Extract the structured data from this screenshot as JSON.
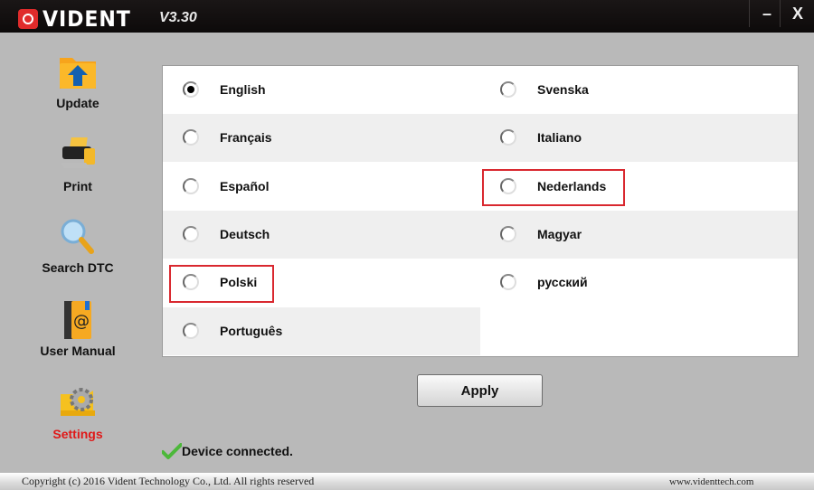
{
  "app": {
    "brand": "VIDENT",
    "version": "V3.30",
    "minimize_label": "–",
    "close_label": "X"
  },
  "sidebar": {
    "items": [
      {
        "label": "Update",
        "icon": "folder-upload-icon",
        "active": false
      },
      {
        "label": "Print",
        "icon": "printer-icon",
        "active": false
      },
      {
        "label": "Search DTC",
        "icon": "magnifier-icon",
        "active": false
      },
      {
        "label": "User Manual",
        "icon": "address-book-icon",
        "active": false
      },
      {
        "label": "Settings",
        "icon": "gear-icon",
        "active": true
      }
    ]
  },
  "languages": {
    "selected": "English",
    "left": [
      "English",
      "Français",
      "Español",
      "Deutsch",
      "Polski",
      "Português"
    ],
    "right": [
      "Svenska",
      "Italiano",
      "Nederlands",
      "Magyar",
      "русский"
    ],
    "highlighted": [
      "Polski",
      "Nederlands"
    ]
  },
  "colors": {
    "highlight": "#d9282f",
    "active_sidebar": "#e01818",
    "brand_red": "#e02b2b"
  },
  "apply_label": "Apply",
  "status": {
    "icon": "check-icon",
    "text": "Device connected."
  },
  "footer": {
    "copyright": "Copyright (c) 2016 Vident Technology Co., Ltd. All rights reserved",
    "website": "www.videnttech.com"
  }
}
